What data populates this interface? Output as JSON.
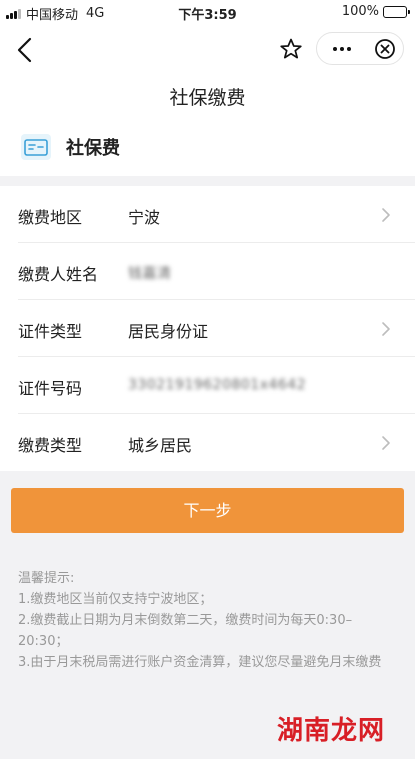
{
  "status_bar": {
    "carrier": "中国移动",
    "network": "4G",
    "time": "下午3:59",
    "battery": "100%"
  },
  "nav": {
    "back_icon": "chevron-left-icon",
    "star_icon": "star-icon",
    "more_icon": "more-dots-icon",
    "close_icon": "close-circle-icon"
  },
  "page": {
    "title": "社保缴费"
  },
  "service": {
    "icon": "social-security-card-icon",
    "name": "社保费"
  },
  "form": {
    "rows": [
      {
        "label": "缴费地区",
        "value": "宁波",
        "has_chevron": true
      },
      {
        "label": "缴费人姓名",
        "value": "钱嘉清",
        "blurred": true,
        "has_chevron": false
      },
      {
        "label": "证件类型",
        "value": "居民身份证",
        "has_chevron": true
      },
      {
        "label": "证件号码",
        "value": "33021919620801x4642",
        "blurred": true,
        "has_chevron": false
      },
      {
        "label": "缴费类型",
        "value": "城乡居民",
        "has_chevron": true
      }
    ]
  },
  "actions": {
    "next_label": "下一步"
  },
  "tips": {
    "heading": "温馨提示:",
    "lines": [
      "1.缴费地区当前仅支持宁波地区；",
      "2.缴费截止日期为月末倒数第二天，缴费时间为每天0:30–20:30；",
      "3.由于月末税局需进行账户资金清算，建议您尽量避免月末缴费"
    ]
  },
  "watermark": {
    "text": "湖南龙网"
  },
  "colors": {
    "accent": "#f0943a",
    "background": "#f2f2f4",
    "tip_text": "#999999",
    "watermark": "#d81f26"
  }
}
